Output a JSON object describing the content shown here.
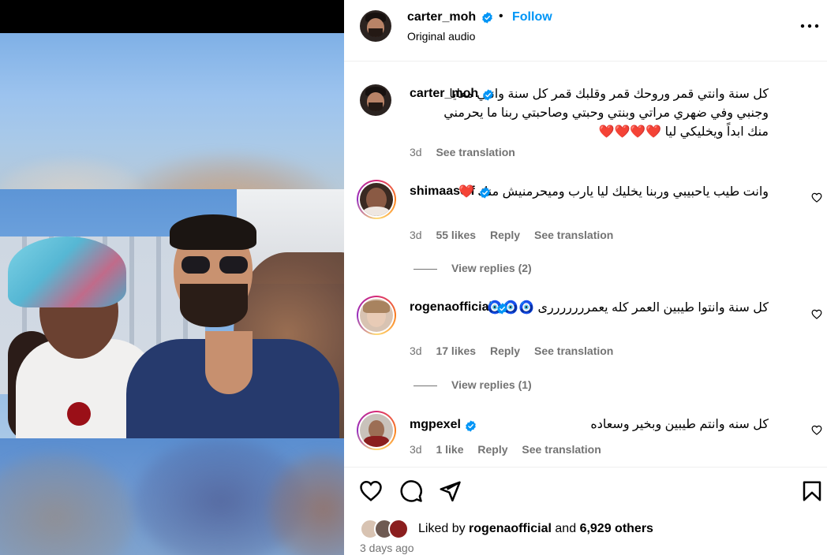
{
  "header": {
    "username": "carter_moh",
    "follow_label": "Follow",
    "subtitle": "Original audio",
    "separator": "•"
  },
  "caption": {
    "username": "carter_moh",
    "text": "كل سنة وانتي قمر وروحك قمر وقلبك قمر كل سنة وانتي معايا وجنبي وفي ضهري مراتي وبنتي وحبتي وصاحبتي ربنا ما يحرمني منك ابداً ويخليكي ليا ❤️❤️❤️❤️",
    "time": "3d",
    "see_translation": "See translation"
  },
  "comments": [
    {
      "username": "shimaaseif",
      "text": "وانت طيب ياحبيبي وربنا يخليك ليا يارب وميحرمنيش منك ❤️",
      "time": "3d",
      "likes": "55 likes",
      "reply": "Reply",
      "see_translation": "See translation",
      "view_replies": "View replies (2)"
    },
    {
      "username": "rogenaofficial",
      "text": "كل سنة وانتوا طيبين العمر كله يعمرررررررى 🧿🧿🧿",
      "time": "3d",
      "likes": "17 likes",
      "reply": "Reply",
      "see_translation": "See translation",
      "view_replies": "View replies (1)"
    },
    {
      "username": "mgpexel",
      "text": "كل سنه وانتم طيبين وبخير وسعاده",
      "time": "3d",
      "likes": "1 like",
      "reply": "Reply",
      "see_translation": "See translation"
    }
  ],
  "likes_bar": {
    "prefix": "Liked by",
    "user": "rogenaofficial",
    "and": "and",
    "others": "6,929 others",
    "ago": "3 days ago"
  },
  "colors": {
    "accent": "#0095f6",
    "muted": "#737373",
    "verified": "#0095f6"
  },
  "icons": [
    "verified-icon",
    "more-icon",
    "heart-icon",
    "comment-icon",
    "share-icon",
    "bookmark-icon"
  ]
}
